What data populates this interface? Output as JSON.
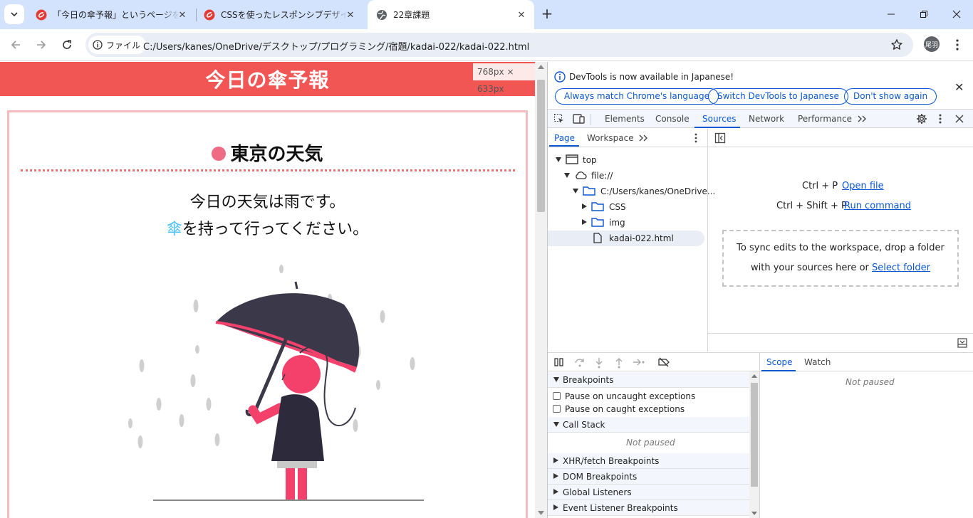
{
  "browser": {
    "tabs": [
      {
        "title": "「今日の傘予報」というページを作成",
        "favicon": "red-circle-logo-icon",
        "active": false
      },
      {
        "title": "CSSを使ったレスポンシブデザインを理",
        "favicon": "red-circle-logo-icon",
        "active": false
      },
      {
        "title": "22章課題",
        "favicon": "globe-icon",
        "active": true
      }
    ],
    "new_tab_label": "+",
    "address": {
      "chip_label": "ファイル",
      "url": "C:/Users/kanes/OneDrive/デスクトップ/プログラミング/宿題/kadai-022/kadai-022.html"
    },
    "profile_initials": "尾羽"
  },
  "page": {
    "header_title": "今日の傘予報",
    "dimension_badge": "768px × 633px",
    "city_heading": "東京の天気",
    "message_line1": "今日の天気は雨です。",
    "message_umbrella": "傘",
    "message_line2_rest": "を持って行ってください。",
    "colors": {
      "header_bg": "#f15654",
      "accent_pink": "#ee6b83",
      "umbrella_blue": "#4fc3f7",
      "card_border": "#f3bcc0"
    }
  },
  "devtools": {
    "infobar": {
      "message": "DevTools is now available in Japanese!",
      "buttons": [
        "Always match Chrome's language",
        "Switch DevTools to Japanese",
        "Don't show again"
      ]
    },
    "tabs": [
      "Elements",
      "Console",
      "Sources",
      "Network",
      "Performance"
    ],
    "selected_tab": "Sources",
    "navigator_tabs": [
      "Page",
      "Workspace"
    ],
    "tree": [
      {
        "label": "top",
        "kind": "frame"
      },
      {
        "label": "file://",
        "kind": "cloud"
      },
      {
        "label": "C:/Users/kanes/OneDrive...",
        "kind": "folder"
      },
      {
        "label": "CSS",
        "kind": "folder"
      },
      {
        "label": "img",
        "kind": "folder"
      },
      {
        "label": "kadai-022.html",
        "kind": "file"
      }
    ],
    "editor": {
      "shortcut1_keys": "Ctrl + P",
      "shortcut1_action": "Open file",
      "shortcut2_keys": "Ctrl + Shift + P",
      "shortcut2_action": "Run command",
      "drop_text_line1": "To sync edits to the workspace, drop a folder",
      "drop_text_line2": "with your sources here or",
      "drop_link": "Select folder"
    },
    "debugger": {
      "breakpoints_label": "Breakpoints",
      "uncaught_label": "Pause on uncaught exceptions",
      "caught_label": "Pause on caught exceptions",
      "callstack_label": "Call Stack",
      "not_paused": "Not paused",
      "xhr_label": "XHR/fetch Breakpoints",
      "dom_label": "DOM Breakpoints",
      "global_label": "Global Listeners",
      "event_label": "Event Listener Breakpoints"
    },
    "scope_tabs": [
      "Scope",
      "Watch"
    ],
    "scope_status": "Not paused"
  }
}
